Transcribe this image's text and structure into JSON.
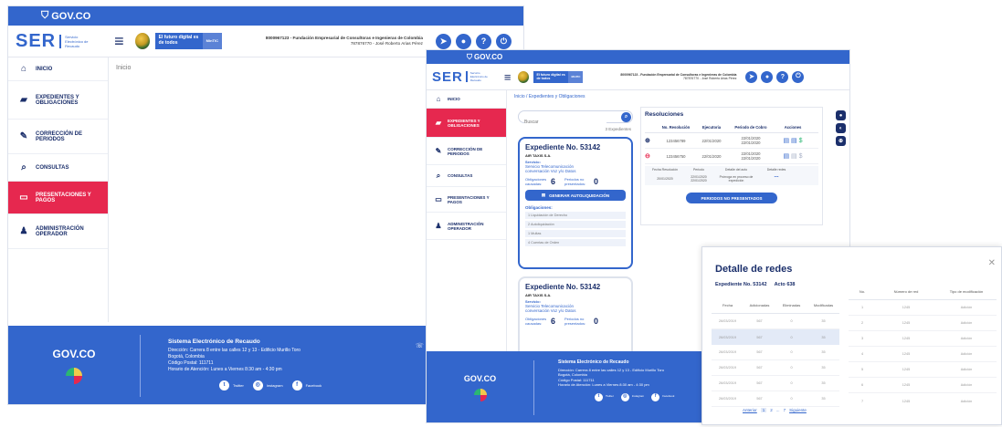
{
  "gov_brand": "GOV.CO",
  "header": {
    "ser": "SER",
    "ser_sub": "Servicio Electrónico de Recaudo",
    "futuro": "El futuro digital es de todos",
    "mintic": "MinTIC",
    "company_line1": "8000967123 - Fundación Empresarial de Consultoras e Ingenieras de Colombia",
    "company_line2": "787876770 - José Roberto Arias Pérez"
  },
  "sidebar": [
    {
      "icon": "home-icon",
      "label": "INICIO"
    },
    {
      "icon": "folder-icon",
      "label": "EXPEDIENTES Y OBLIGACIONES"
    },
    {
      "icon": "edit-icon",
      "label": "CORRECCIÓN DE PERIODOS"
    },
    {
      "icon": "search-icon",
      "label": "CONSULTAS"
    },
    {
      "icon": "payment-icon",
      "label": "PRESENTACIONES Y PAGOS"
    },
    {
      "icon": "user-icon",
      "label": "ADMINISTRACIÓN OPERADOR"
    }
  ],
  "screen1": {
    "breadcrumb": "Inicio"
  },
  "footer": {
    "title": "Sistema Electrónico de Recaudo",
    "l1": "Dirección: Carrera 8 entre las calles 12 y 13 - Edificio Murillo Toro",
    "l2": "Bogotá, Colombia",
    "l3": "Código Postal: 111711",
    "l4": "Horario de Atención: Lunes a Viernes 8:30 am - 4:30 pm",
    "twitter": "Twitter",
    "instagram": "Instagram",
    "facebook": "Facebook"
  },
  "screen2": {
    "breadcrumb": "Inicio / Expedientes y Obligaciones",
    "search_placeholder": "Buscar",
    "count": "3 Expedientes",
    "exp1": {
      "title": "Expediente No. 53142",
      "company": "AIR TAXIS S.A.",
      "servicio_label": "Servicio:",
      "servicio": "Servicio Telecomunicación conversación Voz y/o Datos",
      "causadas_label": "Obligaciones causadas:",
      "causadas": "6",
      "no_pres_label": "Periodos no presentados:",
      "no_pres": "0",
      "btn": "GENERAR AUTOLIQUIDACIÓN",
      "obl_label": "Obligaciones:",
      "obligaciones": [
        "1 Liquidación de Derecho",
        "2 Autoliquidación",
        "1 Multas",
        "4 Cuentas de Orden"
      ]
    },
    "exp2": {
      "title": "Expediente No. 53142",
      "company": "AIR TAXIS S.A.",
      "servicio_label": "Servicio:",
      "servicio": "Servicio Telecomunicación conversación Voz y/o Datos",
      "causadas_label": "Obligaciones causadas:",
      "causadas": "6",
      "no_pres_label": "Periodos no presentados:",
      "no_pres": "0"
    },
    "resol": {
      "title": "Resoluciones",
      "headers": [
        "No. Resolución",
        "Ejecutoria",
        "Periodo de Cobro",
        "Acciones"
      ],
      "rows": [
        {
          "no": "123456789",
          "ej": "22/01/2020",
          "p1": "22/01/2020",
          "p2": "22/01/2020"
        },
        {
          "no": "123456750",
          "ej": "22/01/2020",
          "p1": "22/01/2020",
          "p2": "22/01/2020"
        }
      ],
      "sub_headers": [
        "Fecha Resolución",
        "Periodo",
        "Detalle del acto",
        "Detalle redes"
      ],
      "sub_row": {
        "fecha": "20/01/2020",
        "per1": "22/01/2020",
        "per2": "22/01/2020",
        "det": "Prórroga en proceso de expedición"
      },
      "btn": "PERIODOS NO PRESENTADOS"
    }
  },
  "modal": {
    "title": "Detalle de redes",
    "exp": "Expediente No. 53142",
    "acto": "Acto 638",
    "left_headers": [
      "Fecha",
      "Adicionadas",
      "Eliminadas",
      "Modificadas"
    ],
    "left_rows": [
      [
        "26/03/2019",
        "567",
        "0",
        "35"
      ],
      [
        "26/03/2019",
        "567",
        "0",
        "35"
      ],
      [
        "26/03/2019",
        "567",
        "0",
        "35"
      ],
      [
        "26/03/2019",
        "567",
        "0",
        "35"
      ],
      [
        "26/03/2019",
        "567",
        "0",
        "35"
      ],
      [
        "26/03/2019",
        "567",
        "0",
        "35"
      ]
    ],
    "right_headers": [
      "No.",
      "Número de red",
      "Tipo de modificación"
    ],
    "right_rows": [
      [
        "1",
        "1245",
        "Adición"
      ],
      [
        "2",
        "1245",
        "Adición"
      ],
      [
        "3",
        "1245",
        "Adición"
      ],
      [
        "4",
        "1245",
        "Adición"
      ],
      [
        "5",
        "1245",
        "Adición"
      ],
      [
        "6",
        "1245",
        "Adición"
      ],
      [
        "7",
        "1245",
        "Adición"
      ]
    ],
    "pager": {
      "prev": "Anterior",
      "p1": "1",
      "p2": "2",
      "dots": "...",
      "p7": "7",
      "next": "Siguiente"
    }
  }
}
